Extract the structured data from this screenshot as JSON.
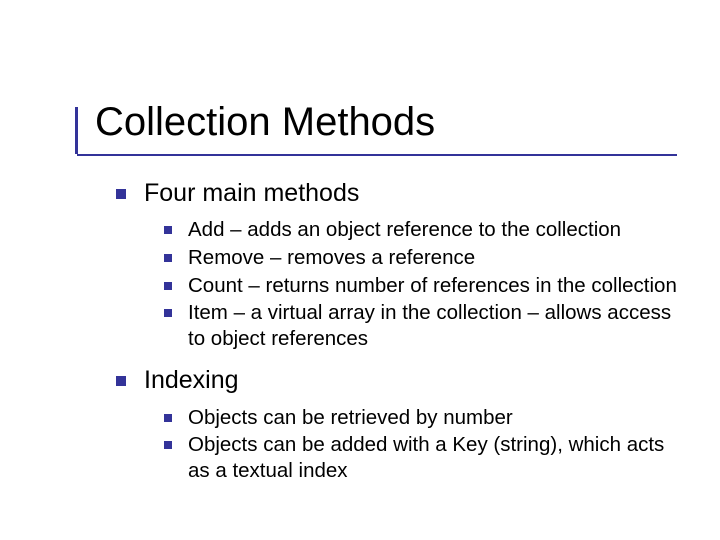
{
  "title": "Collection Methods",
  "sections": [
    {
      "heading": "Four main methods",
      "items": [
        "Add – adds an object reference to the collection",
        "Remove – removes a reference",
        "Count – returns number of references in the collection",
        "Item – a virtual array in the collection – allows access to object references"
      ]
    },
    {
      "heading": "Indexing",
      "items": [
        "Objects can be retrieved by number",
        "Objects can be added with a Key (string), which acts as a textual index"
      ]
    }
  ]
}
